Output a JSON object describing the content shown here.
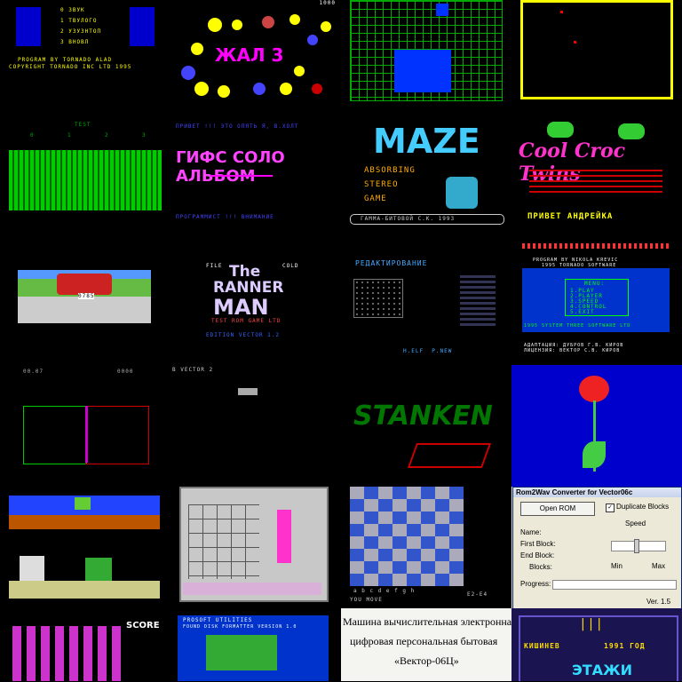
{
  "tiles": {
    "t1": {
      "items": [
        "0 ЗВУК",
        "1 ТВУЛОГО",
        "2 УЗУЗНТОП",
        "3 ВНОВЛ"
      ],
      "line1": "PROGRAM BY TORNADO ALAD",
      "line2": "COPYRIGHT TORNADO INC LTD 1995"
    },
    "t2": {
      "title": "ЖАЛ 3",
      "top": "1000"
    },
    "t4": {},
    "t5": {
      "header": "TEST",
      "nums": [
        "0",
        "1",
        "2",
        "3"
      ]
    },
    "t6": {
      "top": "ПРИВЕТ !!! ЭТО ОПЯТЬ Я, В.ХОЛТ",
      "title": "ГИФС СОЛО АЛЬБОМ",
      "bottom": "ПРОГРАММИСТ !!! ВНИМАНИЕ"
    },
    "t7": {
      "title": "MAZE",
      "l1": "ABSORBING",
      "l2": "STEREO",
      "l3": "GAME",
      "footer": "ГАММА-БИТОВОЙ С.К. 1993"
    },
    "t8": {
      "title": "Cool Croc Twins",
      "footer": "ПРИВЕТ АНДРЕЙКА"
    },
    "t9": {
      "dash": "0785"
    },
    "t10": {
      "a": "FILE",
      "b": "COLD",
      "title1": "The",
      "title2": "RANNER",
      "title3": "MAN",
      "sub": "TEST ROM GAME LTD",
      "sub2": "EDITION VECTOR 1.2"
    },
    "t11": {
      "title": "РЕДАКТИРОВАНИЕ",
      "footer": "Н.ELF  Р.NEW"
    },
    "t12": {
      "l1": "PROGRAM BY NIKOLA KREVIC",
      "l2": "1995 TORNADO SOFTWARE",
      "menu": "MENU:",
      "m1": "1.PLAY",
      "m2": "2.PLAYER",
      "m3": "3.SPEED",
      "m4": "4.CONTROL",
      "m5": "5.EXIT",
      "f1": "1995 SYSTEM THREE SOFTWARE LTD",
      "f2": "АДАПТАЦИЯ: ДУБРОВ Г.В. КИРОВ",
      "f3": "ЛИЦЕНЗИЯ: ВЕКТОР С.В. КИРОВ"
    },
    "t13": {
      "left": "00.07",
      "mid": "0000"
    },
    "t14": {
      "top": "В VECTOR 2"
    },
    "t15": {
      "title": "STANKEN"
    },
    "t16": {},
    "t17": {},
    "t18": {},
    "t19": {
      "files": "a b c d e f g h",
      "status": "YOU MOVE",
      "score": "E2-E4"
    },
    "t20": {
      "window_title": "Rom2Wav Converter for Vector06c",
      "open_rom": "Open ROM",
      "duplicate_blocks": "Duplicate Blocks",
      "speed": "Speed",
      "name": "Name:",
      "first_block": "First Block:",
      "end_block": "End Block:",
      "blocks": "Blocks:",
      "min": "Min",
      "max": "Max",
      "progress": "Progress:",
      "version": "Ver. 1.5"
    },
    "t21": {
      "score": "SCORE"
    },
    "t22": {
      "title": "PROSOFT UTILITIES",
      "sub": "FOUND DISK FORMATTER VERSION 1.0"
    },
    "t23": {
      "l1": "Машина вычислительная электронная",
      "l2": "цифровая персональная бытовая",
      "l3": "«Вектор-06Ц»"
    },
    "t24": {
      "top": "| | |",
      "city": "КИШИНЕВ",
      "year": "1991 ГОД",
      "bottom": "ЭТАЖИ"
    }
  }
}
